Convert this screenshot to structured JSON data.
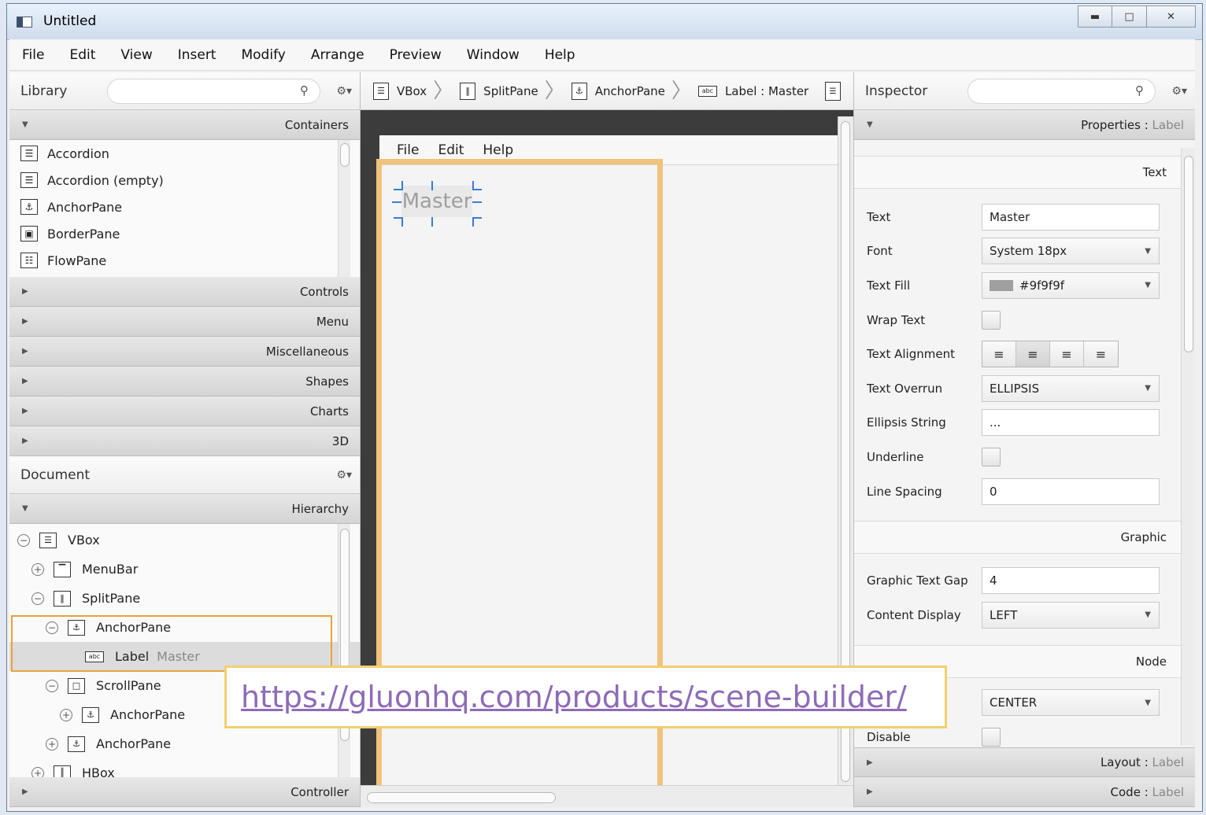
{
  "window": {
    "title": "Untitled"
  },
  "menubar": [
    "File",
    "Edit",
    "View",
    "Insert",
    "Modify",
    "Arrange",
    "Preview",
    "Window",
    "Help"
  ],
  "library": {
    "title": "Library",
    "sections": {
      "containers": "Containers",
      "others": [
        "Controls",
        "Menu",
        "Miscellaneous",
        "Shapes",
        "Charts",
        "3D"
      ]
    },
    "items": [
      {
        "label": "Accordion",
        "icon": "accordion-icon",
        "glyph": "☰"
      },
      {
        "label": "Accordion  (empty)",
        "icon": "accordion-icon",
        "glyph": "☰"
      },
      {
        "label": "AnchorPane",
        "icon": "anchor-icon",
        "glyph": "⚓"
      },
      {
        "label": "BorderPane",
        "icon": "borderpane-icon",
        "glyph": "▣"
      },
      {
        "label": "FlowPane",
        "icon": "flowpane-icon",
        "glyph": "☷"
      }
    ]
  },
  "document": {
    "title": "Document",
    "hierarchy_label": "Hierarchy",
    "controller_label": "Controller",
    "tree": [
      {
        "label": "VBox",
        "indent": 0,
        "toggle": "−",
        "glyph": "☰"
      },
      {
        "label": "MenuBar",
        "indent": 1,
        "toggle": "+",
        "glyph": "▔"
      },
      {
        "label": "SplitPane",
        "indent": 1,
        "toggle": "−",
        "glyph": "‖"
      },
      {
        "label": "AnchorPane",
        "indent": 2,
        "toggle": "−",
        "glyph": "⚓"
      },
      {
        "label": "Label",
        "sub": "Master",
        "indent": 4,
        "toggle": "",
        "glyph": "abc"
      },
      {
        "label": "ScrollPane",
        "indent": 2,
        "toggle": "−",
        "glyph": "□"
      },
      {
        "label": "AnchorPane",
        "indent": 3,
        "toggle": "+",
        "glyph": "⚓"
      },
      {
        "label": "AnchorPane",
        "indent": 2,
        "toggle": "+",
        "glyph": "⚓"
      },
      {
        "label": "HBox",
        "indent": 1,
        "toggle": "+",
        "glyph": "║"
      }
    ]
  },
  "breadcrumb": [
    {
      "label": "VBox",
      "glyph": "☰"
    },
    {
      "label": "SplitPane",
      "glyph": "‖"
    },
    {
      "label": "AnchorPane",
      "glyph": "⚓"
    },
    {
      "label": "Label : Master",
      "glyph": "abc"
    }
  ],
  "canvas": {
    "menu": [
      "File",
      "Edit",
      "Help"
    ],
    "label_text": "Master"
  },
  "inspector": {
    "title": "Inspector",
    "properties_label": "Properties",
    "properties_target": "Label",
    "group_text": "Text",
    "group_graphic": "Graphic",
    "group_node": "Node",
    "props": {
      "text": {
        "label": "Text",
        "value": "Master"
      },
      "font": {
        "label": "Font",
        "value": "System 18px"
      },
      "text_fill": {
        "label": "Text Fill",
        "value": "#9f9f9f"
      },
      "wrap_text": {
        "label": "Wrap Text"
      },
      "text_alignment": {
        "label": "Text Alignment"
      },
      "text_overrun": {
        "label": "Text Overrun",
        "value": "ELLIPSIS"
      },
      "ellipsis_string": {
        "label": "Ellipsis String",
        "value": "..."
      },
      "underline": {
        "label": "Underline"
      },
      "line_spacing": {
        "label": "Line Spacing",
        "value": "0"
      },
      "graphic_text_gap": {
        "label": "Graphic Text Gap",
        "value": "4"
      },
      "content_display": {
        "label": "Content Display",
        "value": "LEFT"
      },
      "node_alignment_value": "CENTER",
      "disable": {
        "label": "Disable"
      }
    },
    "layout_label": "Layout",
    "code_label": "Code",
    "target": "Label"
  },
  "overlay_url": "https://gluonhq.com/products/scene-builder/",
  "colors": {
    "selection": "#e8a23a",
    "canvas_outline": "#f0c27a",
    "text_fill": "#9f9f9f",
    "url": "#8e6bb8"
  }
}
